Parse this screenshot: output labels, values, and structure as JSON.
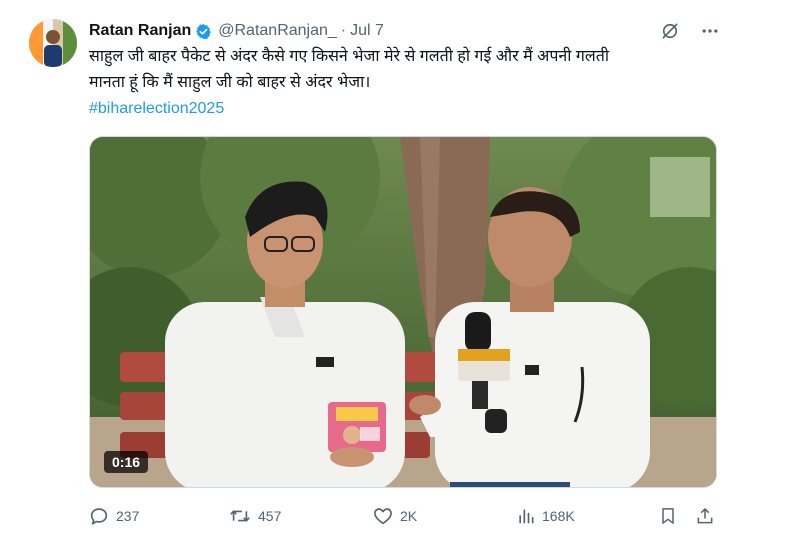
{
  "tweet": {
    "author_name": "Ratan Ranjan",
    "handle": "@RatanRanjan_",
    "separator": "·",
    "date": "Jul 7",
    "text_line1": "साहुल जी बाहर पैकेट से अंदर कैसे गए किसने भेजा मेरे से गलती हो गई और मैं अपनी गलती",
    "text_line2": "मानता हूं कि मैं साहुल जी को बाहर से अंदर भेजा।",
    "hashtag": "#biharelection2025"
  },
  "media": {
    "duration": "0:16",
    "mic_label": "AAZAAZ"
  },
  "actions": {
    "replies": "237",
    "reposts": "457",
    "likes": "2K",
    "views": "168K"
  },
  "icons": {
    "verified": "verified-badge-icon",
    "grok": "grok-icon",
    "more": "more-icon",
    "reply": "reply-icon",
    "repost": "repost-icon",
    "like": "heart-icon",
    "views": "views-icon",
    "bookmark": "bookmark-icon",
    "share": "share-icon"
  },
  "colors": {
    "accent": "#1d9bf0",
    "muted": "#536471",
    "text": "#0f1419"
  }
}
